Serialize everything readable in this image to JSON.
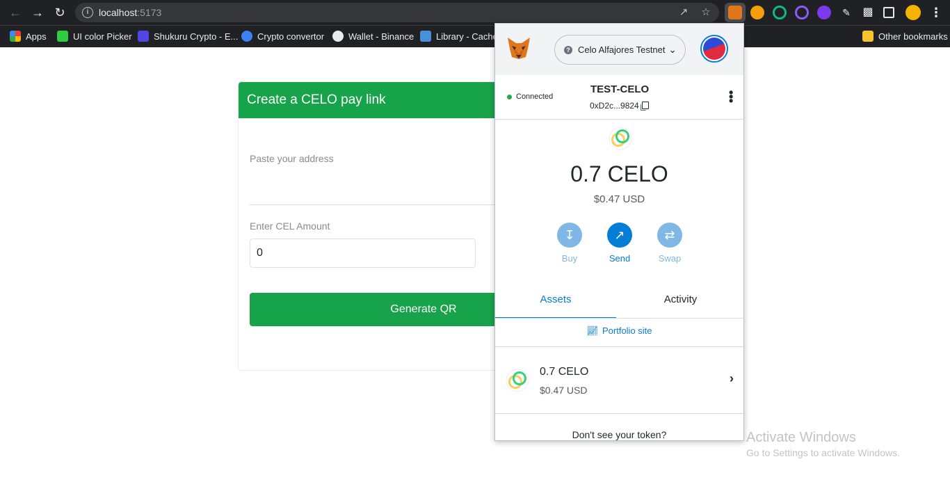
{
  "browser": {
    "url_host": "localhost",
    "url_port": ":5173",
    "bookmarks": [
      {
        "label": "Apps",
        "color": "#ea4335"
      },
      {
        "label": "UI color Picker",
        "color": "#2ecc40"
      },
      {
        "label": "Shukuru Crypto - E...",
        "color": "#4f46e5"
      },
      {
        "label": "Crypto convertor",
        "color": "#3b82f6"
      },
      {
        "label": "Wallet - Binance",
        "color": "#e8eaed"
      },
      {
        "label": "Library - Cacher",
        "color": "#4a90d9"
      }
    ],
    "other_bookmarks": "Other bookmarks"
  },
  "page": {
    "card_title": "Create a CELO pay link",
    "address_label": "Paste your address",
    "amount_label": "Enter CEL Amount",
    "amount_value": "0",
    "generate_label": "Generate QR",
    "accent": "#17a34a"
  },
  "metamask": {
    "network": "Celo Alfajores Testnet",
    "connection_status": "Connected",
    "account_name": "TEST-CELO",
    "account_address": "0xD2c...9824",
    "balance": "0.7 CELO",
    "balance_usd": "$0.47 USD",
    "actions": [
      {
        "label": "Buy",
        "icon": "download-icon",
        "active": false
      },
      {
        "label": "Send",
        "icon": "arrow-up-right-icon",
        "active": true
      },
      {
        "label": "Swap",
        "icon": "swap-icon",
        "active": false
      }
    ],
    "tabs": [
      "Assets",
      "Activity"
    ],
    "portfolio_link": "Portfolio site",
    "asset": {
      "amount": "0.7 CELO",
      "usd": "$0.47 USD"
    },
    "dont_see_token": "Don't see your token?",
    "accent": "#037dd6"
  },
  "watermark": {
    "line1": "Activate Windows",
    "line2": "Go to Settings to activate Windows."
  }
}
